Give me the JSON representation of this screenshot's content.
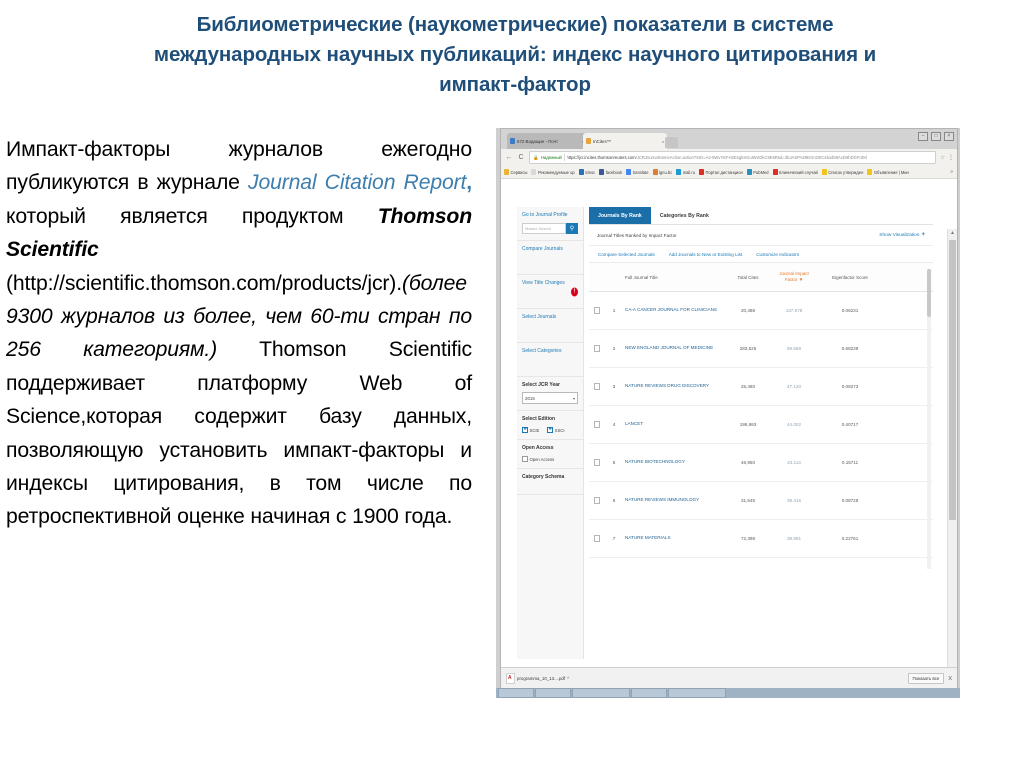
{
  "slide": {
    "title": "Библиометрические (наукометрические) показатели в системе международных научных публикаций: индекс научного цитирования и импакт-фактор",
    "body": {
      "seg1": "Импакт-факторы журналов ежегодно публикуются в журнале ",
      "journal_name": "Journal Citation Report",
      "comma": ",",
      "seg2": " который является продуктом ",
      "product": "Thomson Scientific",
      "seg3": " (http://scientific.thomson.com/products/jcr).",
      "paren": "(более 9300 журналов из более, чем 60-ти стран по 256 категориям.)",
      "seg4": " Thomson Scientific поддерживает платформу Web of Science,которая содержит базу данных, позволяющую установить импакт-факторы и индексы цитирования, в том числе по ретроспективной оценке начиная с 1900 года."
    }
  },
  "browser": {
    "tabs": [
      {
        "label": "672 Водащие - Почт",
        "close": "x",
        "color": "#3b7cc4"
      },
      {
        "label": "InCites™",
        "close": "x",
        "color": "#e8a33d"
      }
    ],
    "new_tab_icon": "new-tab-icon",
    "window_controls": [
      "minimize",
      "maximize",
      "close"
    ],
    "nav": {
      "back": "←",
      "forward": "→",
      "reload": "C"
    },
    "omnibox": {
      "lock_icon": "lock-icon",
      "secure_label": "Надежный",
      "url_visible": "https://jcr.incites.thomsonreuters.com",
      "url_rest": "/JCRJournalHomeAction.action?SID=A2-5WvYEFH2EsgkSGuIW2OkC9E5Rsd=3bJASPAZ8EGnz0IC4bxd59AcD6hDGFrZKl",
      "star_icon": "bookmark-star-icon",
      "menu_icon": "kebab-menu-icon"
    },
    "bookmarks": [
      {
        "label": "Сервисы",
        "icon": "apps-icon",
        "color": "#e8b53a"
      },
      {
        "label": "Рекомендуемые up",
        "icon": "folder-icon",
        "color": "#d8d8d8"
      },
      {
        "label": "Sinsc",
        "icon": "site-icon",
        "color": "#2d6fb5"
      },
      {
        "label": "facebook",
        "icon": "facebook-icon",
        "color": "#3b5998"
      },
      {
        "label": "translate",
        "icon": "translate-icon",
        "color": "#4285f4"
      },
      {
        "label": "lgnu.bc",
        "icon": "site-icon",
        "color": "#e07b39"
      },
      {
        "label": "mail.ru",
        "icon": "mail-icon",
        "color": "#1b9ad6"
      },
      {
        "label": "Портал дистанцион",
        "icon": "site-icon",
        "color": "#d93025"
      },
      {
        "label": "PubMed",
        "icon": "pubmed-icon",
        "color": "#2a8fbd"
      },
      {
        "label": "Клинический случай",
        "icon": "site-icon",
        "color": "#d93025"
      },
      {
        "label": "Список утвержден",
        "icon": "site-icon",
        "color": "#f0c419"
      },
      {
        "label": "Объявления | Мин",
        "icon": "site-icon",
        "color": "#f0c419"
      }
    ],
    "bookmarks_overflow": "»",
    "download_shelf": {
      "file_name": "programma_10_13....pdf",
      "caret": "^",
      "show_all": "Показать все",
      "close": "X",
      "file_icon": "pdf-file-icon"
    }
  },
  "jcr": {
    "sidebar": {
      "go_to_profile": "Go to Journal Profile",
      "search_placeholder": "Master Search",
      "search_icon": "search-icon",
      "compare_journals": "Compare Journals",
      "view_title_changes": "View Title Changes",
      "alert_badge": "!",
      "select_journals": "Select Journals",
      "select_categories": "Select Categories",
      "select_jcr_year": "Select JCR Year",
      "jcr_year_value": "2015",
      "select_edition": "Select Edition",
      "edition_scie": "SCIE",
      "edition_ssci": "SSCI",
      "open_access_heading": "Open Access",
      "open_access_option": "Open Access",
      "category_schema": "Category Schema"
    },
    "tabs": [
      {
        "label": "Journals By Rank",
        "selected": true
      },
      {
        "label": "Categories By Rank",
        "selected": false
      }
    ],
    "subhead": {
      "left": "Journal Titles Ranked by Impact Factor",
      "right": "Show Visualization",
      "plus": "+"
    },
    "actions": [
      "Compare Selected Journals",
      "Add Journals to New or Existing List",
      "Customize Indicators"
    ],
    "table": {
      "columns": [
        "",
        "",
        "Full Journal Title",
        "Total Cites",
        "Journal Impact Factor",
        "Eigenfactor Score"
      ],
      "sort_indicator": "▼",
      "rows": [
        {
          "rank": "1",
          "title": "CA-A CANCER JOURNAL FOR CLINICIANS",
          "total_cites": "20,488",
          "jif": "137.578",
          "eigenfactor": "0.06231"
        },
        {
          "rank": "2",
          "title": "NEW ENGLAND JOURNAL OF MEDICINE",
          "total_cites": "283,525",
          "jif": "59.558",
          "eigenfactor": "0.68239"
        },
        {
          "rank": "3",
          "title": "NATURE REVIEWS DRUG DISCOVERY",
          "total_cites": "25,460",
          "jif": "47.120",
          "eigenfactor": "0.08273"
        },
        {
          "rank": "4",
          "title": "LANCET",
          "total_cites": "195,993",
          "jif": "44.002",
          "eigenfactor": "0.40717"
        },
        {
          "rank": "5",
          "title": "NATURE BIOTECHNOLOGY",
          "total_cites": "46,950",
          "jif": "43.113",
          "eigenfactor": "0.15711"
        },
        {
          "rank": "6",
          "title": "NATURE REVIEWS IMMUNOLOGY",
          "total_cites": "31,545",
          "jif": "39.416",
          "eigenfactor": "0.08728"
        },
        {
          "rank": "7",
          "title": "NATURE MATERIALS",
          "total_cites": "72,398",
          "jif": "38.891",
          "eigenfactor": "0.22761"
        }
      ]
    }
  },
  "colors": {
    "title_blue": "#1F4E79",
    "link_blue": "#3D7EAE",
    "jcr_blue": "#1b7ab5",
    "jcr_tab_blue": "#1b6fa8",
    "jif_orange": "#e8762c",
    "alert_red": "#d9001b"
  }
}
